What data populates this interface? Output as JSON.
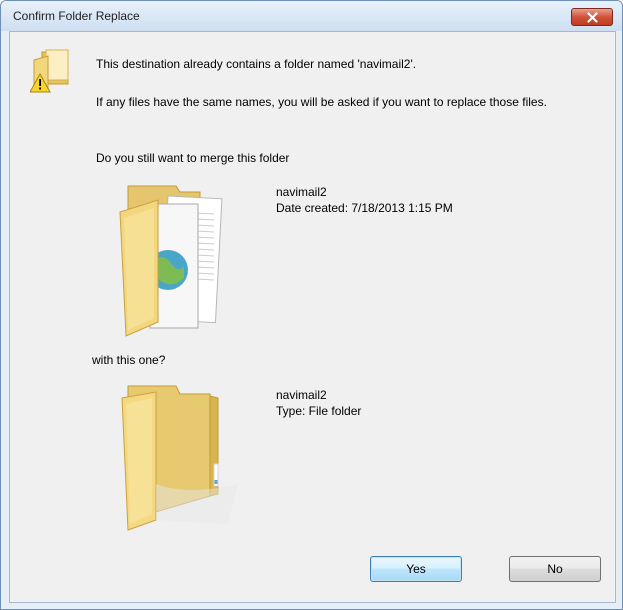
{
  "window": {
    "title": "Confirm Folder Replace",
    "close_icon": "close-icon"
  },
  "message": {
    "line1": "This destination already contains a folder named 'navimail2'.",
    "line2": "If any files have the same names, you will be asked if you want to replace those files.",
    "line3": "Do you still want to merge this folder",
    "line4": "with this one?"
  },
  "existing_folder": {
    "name": "navimail2",
    "detail": "Date created: 7/18/2013 1:15 PM",
    "icon": "folder-with-documents-icon"
  },
  "new_folder": {
    "name": "navimail2",
    "detail": "Type: File folder",
    "icon": "empty-folder-icon"
  },
  "buttons": {
    "yes": "Yes",
    "no": "No"
  },
  "colors": {
    "title_bg": "#dbe7f5",
    "client_bg": "#f0f0f0",
    "close_red": "#c8452a",
    "folder_yellow": "#f1d57e"
  }
}
